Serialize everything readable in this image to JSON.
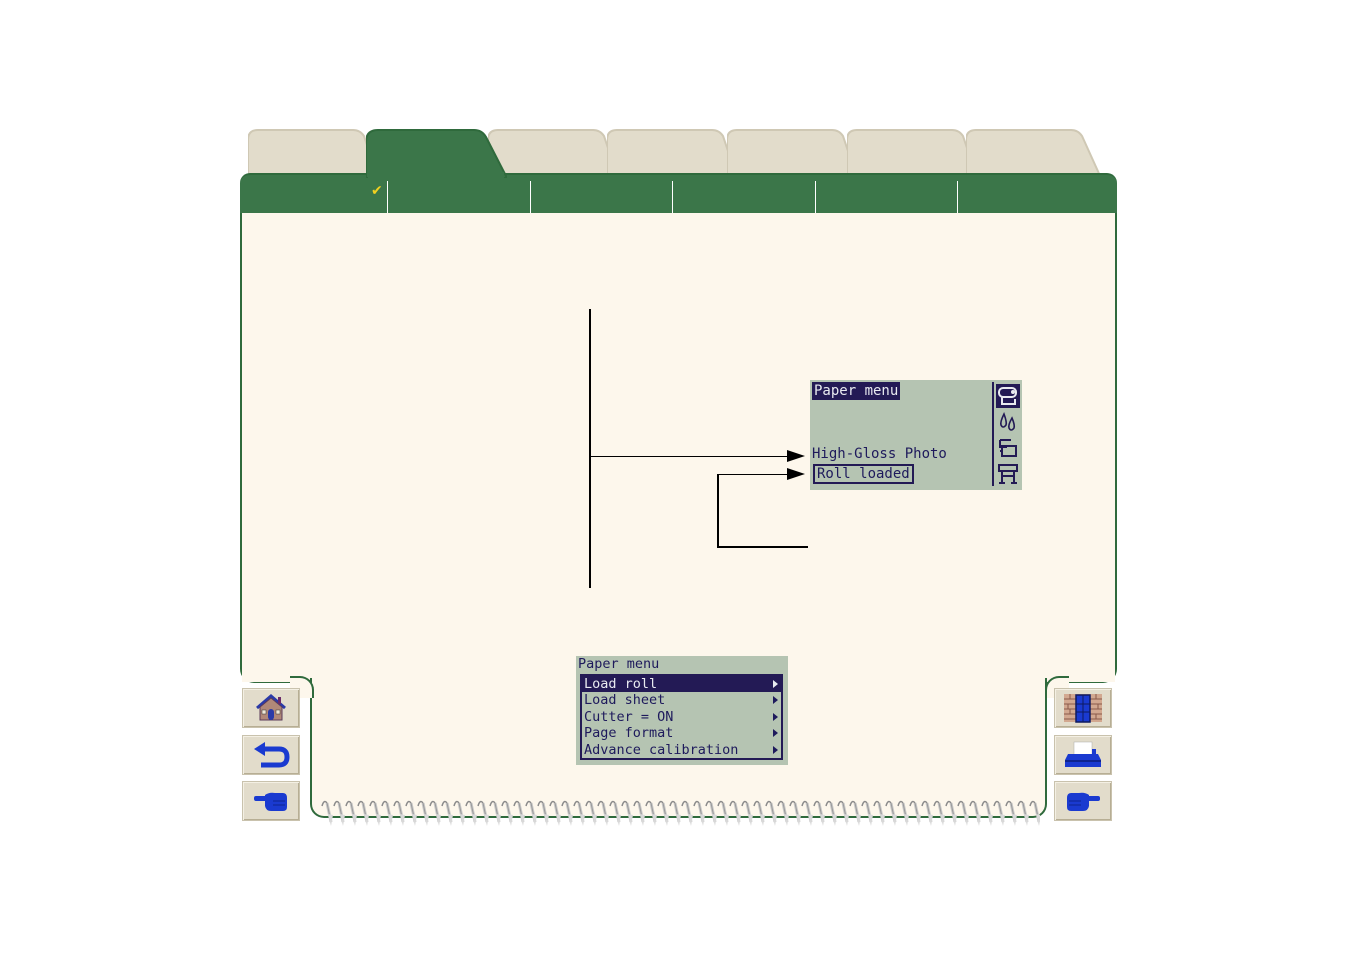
{
  "tabs": [
    {
      "label": "",
      "active": false
    },
    {
      "label": "",
      "active": true
    },
    {
      "label": "",
      "active": false
    },
    {
      "label": "",
      "active": false
    },
    {
      "label": "",
      "active": false
    },
    {
      "label": "",
      "active": false
    },
    {
      "label": "",
      "active": false
    }
  ],
  "tabbar": {
    "check_glyph": "✔",
    "segments": [
      "",
      "",
      "",
      "",
      "",
      ""
    ]
  },
  "colors": {
    "accent_green": "#3b7649",
    "page_bg": "#fdf7ec",
    "lcd_bg": "#b5c4b2",
    "lcd_ink": "#231a55",
    "check_yellow": "#f0d020"
  },
  "front_panel_status": {
    "title": "Paper menu",
    "media": "High-Gloss Photo",
    "status": "Roll loaded",
    "icons": [
      "paper-roll-icon",
      "ink-drops-icon",
      "sheet-stack-icon",
      "printer-stand-icon"
    ]
  },
  "paper_menu": {
    "title": "Paper menu",
    "items": [
      {
        "label": "Load roll",
        "selected": true
      },
      {
        "label": "Load sheet",
        "selected": false
      },
      {
        "label": "Cutter = ON",
        "selected": false
      },
      {
        "label": "Page format",
        "selected": false
      },
      {
        "label": "Advance calibration",
        "selected": false
      }
    ]
  },
  "nav": {
    "left": [
      "home-icon",
      "back-icon",
      "next-page-left-icon"
    ],
    "right": [
      "exit-door-icon",
      "printer-icon",
      "next-page-right-icon"
    ]
  }
}
